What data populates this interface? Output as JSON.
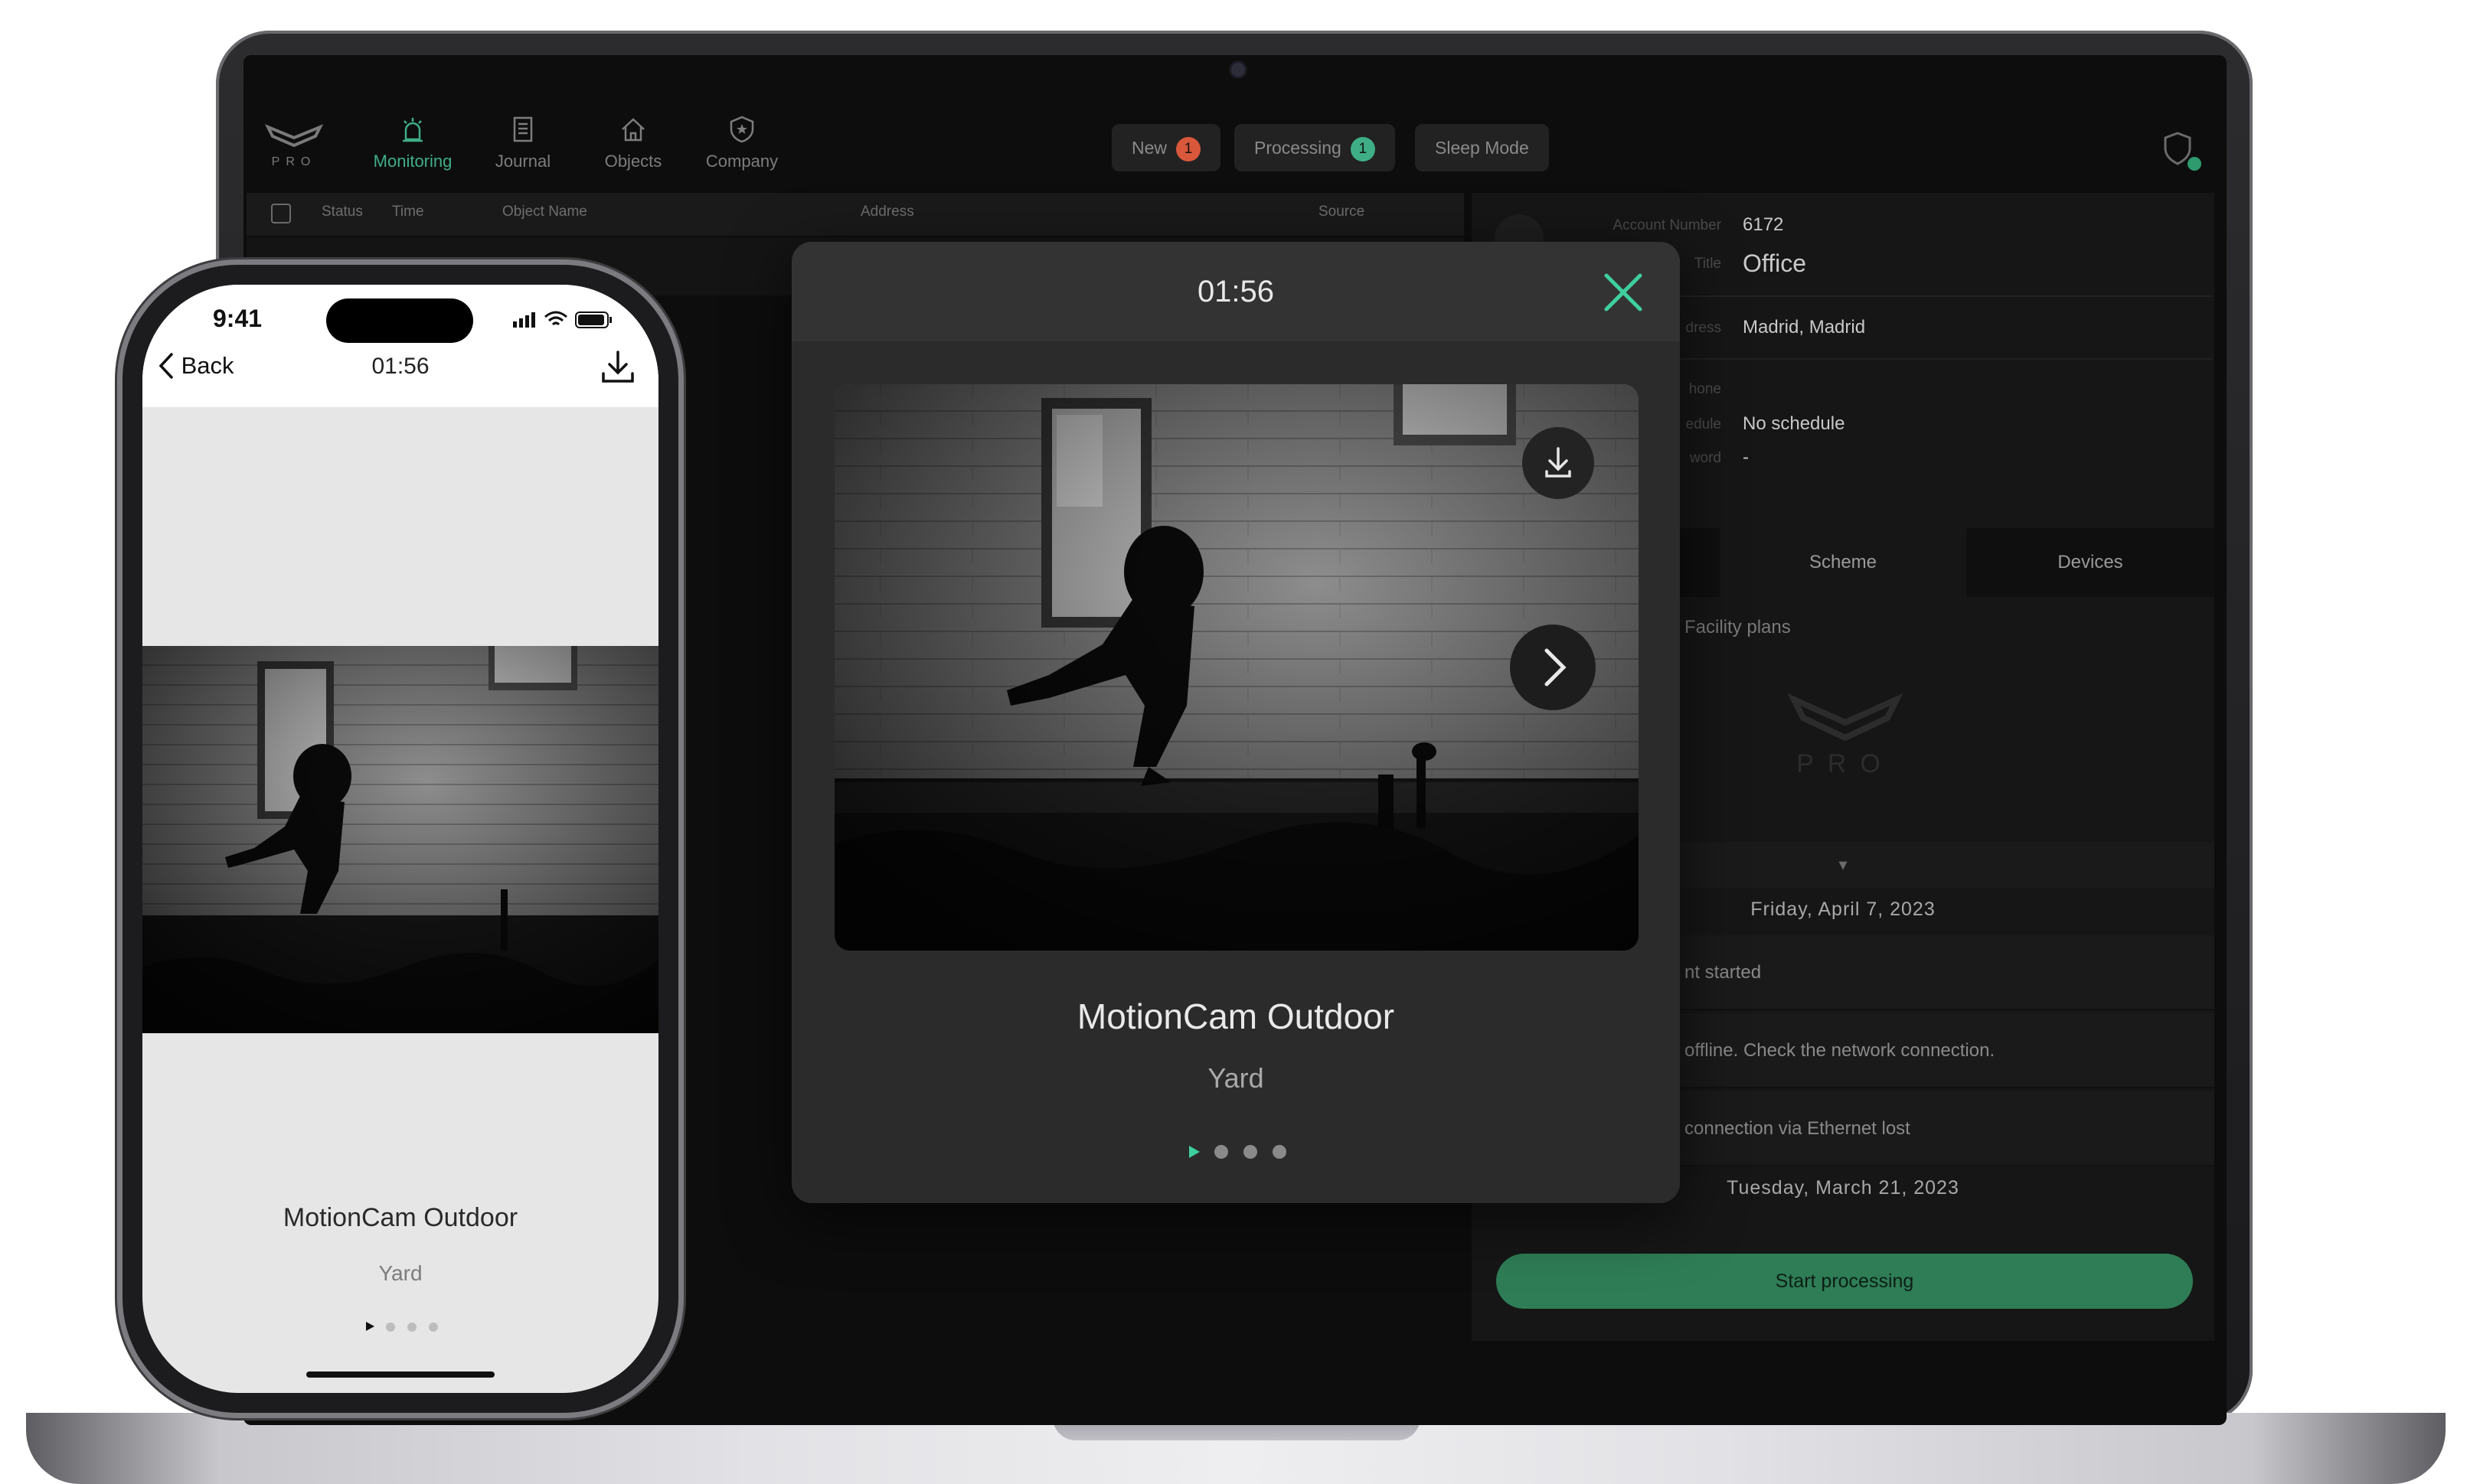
{
  "desktop": {
    "logo_text": "PRO",
    "nav": [
      {
        "label": "Monitoring",
        "icon": "siren-icon",
        "active": true
      },
      {
        "label": "Journal",
        "icon": "journal-icon",
        "active": false
      },
      {
        "label": "Objects",
        "icon": "home-icon",
        "active": false
      },
      {
        "label": "Company",
        "icon": "shield-star-icon",
        "active": false
      }
    ],
    "filters": {
      "new_label": "New",
      "new_count": "1",
      "processing_label": "Processing",
      "processing_count": "1",
      "sleep_label": "Sleep Mode"
    },
    "table_headers": {
      "status": "Status",
      "time": "Time",
      "object_name": "Object Name",
      "address": "Address",
      "source": "Source"
    },
    "details": {
      "account_label": "Account Number",
      "account_value": "6172",
      "title_label": "Title",
      "title_value": "Office",
      "address_label": "dress",
      "address_value": "Madrid, Madrid",
      "phone_label": "hone",
      "schedule_label": "edule",
      "schedule_value": "No schedule",
      "password_label": "word",
      "password_value": "-"
    },
    "tabs": {
      "scheme": "Scheme",
      "devices": "Devices"
    },
    "facility_plans": "Facility plans",
    "watermark_logo": "PRO",
    "events": {
      "date1": "Friday, April 7, 2023",
      "event1": "nt started",
      "event2": "offline. Check the network connection.",
      "event3": "connection via Ethernet lost",
      "date2": "Tuesday, March 21, 2023"
    },
    "start_processing": "Start processing",
    "colors": {
      "accent": "#3fae86",
      "badge_new": "#d9573b",
      "badge_processing": "#3fae86",
      "button": "#2e7d56"
    }
  },
  "modal": {
    "time": "01:56",
    "device": "MotionCam Outdoor",
    "room": "Yard",
    "photo_count": 4,
    "active_index": 0
  },
  "phone": {
    "status_time": "9:41",
    "back_label": "Back",
    "title": "01:56",
    "device": "MotionCam Outdoor",
    "room": "Yard",
    "photo_count": 4,
    "active_index": 0
  }
}
